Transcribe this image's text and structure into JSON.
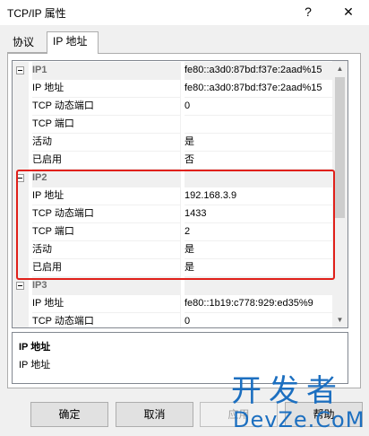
{
  "window": {
    "title": "TCP/IP 属性",
    "help_label": "?",
    "close_label": "✕"
  },
  "tabs": [
    {
      "label": "协议",
      "active": false
    },
    {
      "label": "IP 地址",
      "active": true
    }
  ],
  "grid": {
    "rows": [
      {
        "kind": "category",
        "name": "IP1",
        "value": "fe80::a3d0:87bd:f37e:2aad%15"
      },
      {
        "kind": "property",
        "name": "IP 地址",
        "value": "fe80::a3d0:87bd:f37e:2aad%15"
      },
      {
        "kind": "property",
        "name": "TCP 动态端口",
        "value": "0"
      },
      {
        "kind": "property",
        "name": "TCP 端口",
        "value": ""
      },
      {
        "kind": "property",
        "name": "活动",
        "value": "是"
      },
      {
        "kind": "property",
        "name": "已启用",
        "value": "否"
      },
      {
        "kind": "category",
        "name": "IP2",
        "value": ""
      },
      {
        "kind": "property",
        "name": "IP 地址",
        "value": "192.168.3.9"
      },
      {
        "kind": "property",
        "name": "TCP 动态端口",
        "value": "1433"
      },
      {
        "kind": "property",
        "name": "TCP 端口",
        "value": "2"
      },
      {
        "kind": "property",
        "name": "活动",
        "value": "是"
      },
      {
        "kind": "property",
        "name": "已启用",
        "value": "是"
      },
      {
        "kind": "category",
        "name": "IP3",
        "value": ""
      },
      {
        "kind": "property",
        "name": "IP 地址",
        "value": "fe80::1b19:c778:929:ed35%9"
      },
      {
        "kind": "property",
        "name": "TCP 动态端口",
        "value": "0"
      }
    ],
    "scrollbar_position": 0
  },
  "description": {
    "title": "IP 地址",
    "text": "IP 地址"
  },
  "buttons": {
    "ok": "确定",
    "cancel": "取消",
    "apply": "应用",
    "help": "帮助"
  },
  "watermark": {
    "cn": "开发者",
    "en": "DevZe.CoM"
  },
  "colors": {
    "highlight": "#e0201a",
    "watermark": "#1c6fc0"
  }
}
